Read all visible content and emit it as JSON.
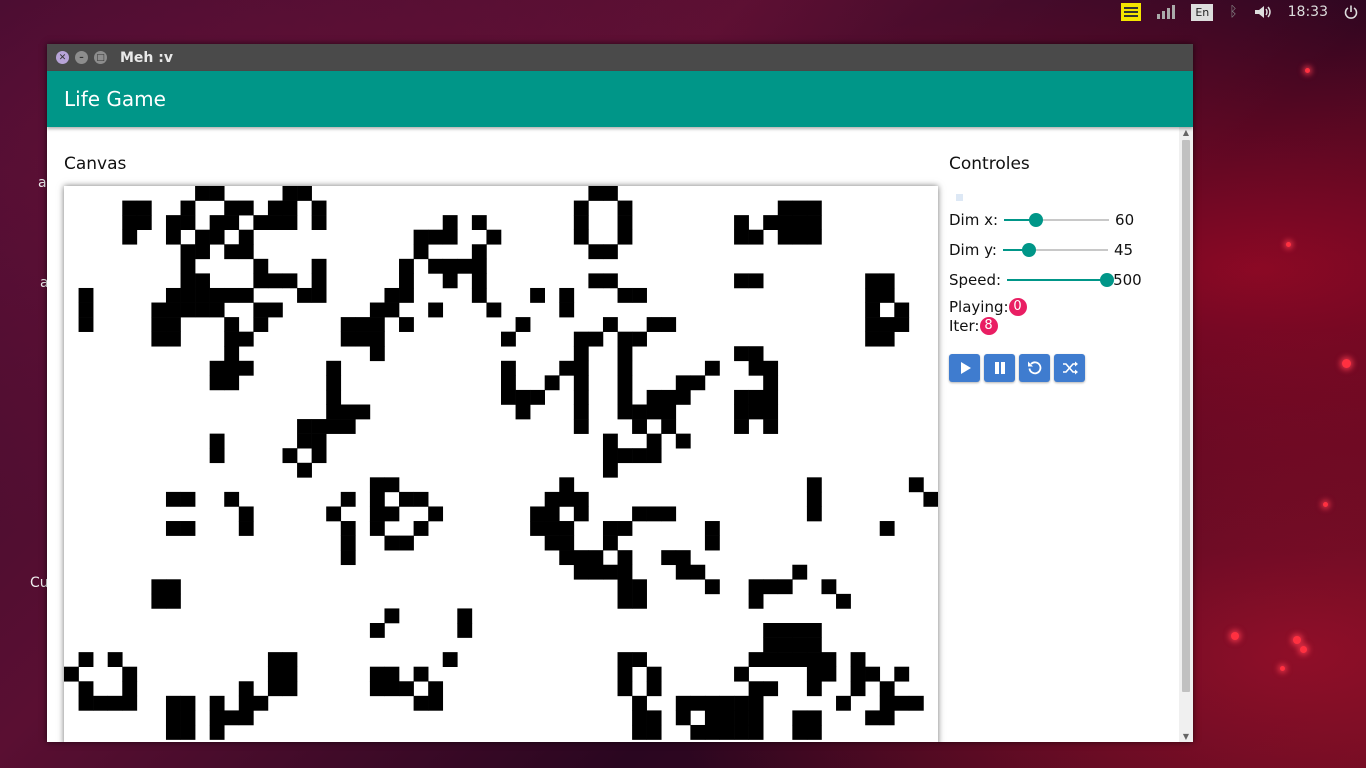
{
  "top_panel": {
    "language": "En",
    "clock": "18:33"
  },
  "desktop": {
    "glyphs": [
      "a",
      "a",
      "Cu"
    ]
  },
  "window": {
    "title": "Meh :v",
    "app_title": "Life Game",
    "canvas_heading": "Canvas",
    "controls_heading": "Controles",
    "sliders": [
      {
        "label": "Dim x:",
        "value": "60",
        "level": 0.3
      },
      {
        "label": "Dim y:",
        "value": "45",
        "level": 0.25
      },
      {
        "label": "Speed:",
        "value": "500",
        "level": 1.0
      }
    ],
    "playing_label": "Playing:",
    "playing_value": "0",
    "iter_label": "Iter:",
    "iter_value": "8",
    "buttons": [
      "play-icon",
      "pause-icon",
      "reset-icon",
      "shuffle-icon"
    ],
    "accent_color": "#009688",
    "button_color": "#3f7ccf",
    "badge_color": "#e91e63"
  },
  "grid": {
    "cols": 60,
    "visible_rows": 38,
    "live_cells": [
      [
        9,
        0
      ],
      [
        10,
        0
      ],
      [
        15,
        0
      ],
      [
        16,
        0
      ],
      [
        36,
        0
      ],
      [
        37,
        0
      ],
      [
        4,
        1
      ],
      [
        5,
        1
      ],
      [
        8,
        1
      ],
      [
        11,
        1
      ],
      [
        12,
        1
      ],
      [
        14,
        1
      ],
      [
        15,
        1
      ],
      [
        17,
        1
      ],
      [
        35,
        1
      ],
      [
        38,
        1
      ],
      [
        49,
        1
      ],
      [
        50,
        1
      ],
      [
        51,
        1
      ],
      [
        4,
        2
      ],
      [
        5,
        2
      ],
      [
        7,
        2
      ],
      [
        8,
        2
      ],
      [
        10,
        2
      ],
      [
        11,
        2
      ],
      [
        13,
        2
      ],
      [
        14,
        2
      ],
      [
        15,
        2
      ],
      [
        17,
        2
      ],
      [
        26,
        2
      ],
      [
        28,
        2
      ],
      [
        35,
        2
      ],
      [
        38,
        2
      ],
      [
        46,
        2
      ],
      [
        48,
        2
      ],
      [
        49,
        2
      ],
      [
        50,
        2
      ],
      [
        51,
        2
      ],
      [
        4,
        3
      ],
      [
        7,
        3
      ],
      [
        9,
        3
      ],
      [
        10,
        3
      ],
      [
        12,
        3
      ],
      [
        24,
        3
      ],
      [
        25,
        3
      ],
      [
        26,
        3
      ],
      [
        29,
        3
      ],
      [
        35,
        3
      ],
      [
        38,
        3
      ],
      [
        46,
        3
      ],
      [
        47,
        3
      ],
      [
        49,
        3
      ],
      [
        50,
        3
      ],
      [
        51,
        3
      ],
      [
        8,
        4
      ],
      [
        9,
        4
      ],
      [
        11,
        4
      ],
      [
        12,
        4
      ],
      [
        24,
        4
      ],
      [
        28,
        4
      ],
      [
        36,
        4
      ],
      [
        37,
        4
      ],
      [
        8,
        5
      ],
      [
        13,
        5
      ],
      [
        17,
        5
      ],
      [
        23,
        5
      ],
      [
        25,
        5
      ],
      [
        26,
        5
      ],
      [
        27,
        5
      ],
      [
        28,
        5
      ],
      [
        8,
        6
      ],
      [
        9,
        6
      ],
      [
        13,
        6
      ],
      [
        14,
        6
      ],
      [
        15,
        6
      ],
      [
        17,
        6
      ],
      [
        23,
        6
      ],
      [
        26,
        6
      ],
      [
        28,
        6
      ],
      [
        36,
        6
      ],
      [
        37,
        6
      ],
      [
        46,
        6
      ],
      [
        47,
        6
      ],
      [
        55,
        6
      ],
      [
        56,
        6
      ],
      [
        1,
        7
      ],
      [
        7,
        7
      ],
      [
        8,
        7
      ],
      [
        9,
        7
      ],
      [
        10,
        7
      ],
      [
        11,
        7
      ],
      [
        12,
        7
      ],
      [
        16,
        7
      ],
      [
        17,
        7
      ],
      [
        22,
        7
      ],
      [
        23,
        7
      ],
      [
        28,
        7
      ],
      [
        32,
        7
      ],
      [
        34,
        7
      ],
      [
        38,
        7
      ],
      [
        39,
        7
      ],
      [
        55,
        7
      ],
      [
        56,
        7
      ],
      [
        1,
        8
      ],
      [
        6,
        8
      ],
      [
        7,
        8
      ],
      [
        8,
        8
      ],
      [
        9,
        8
      ],
      [
        10,
        8
      ],
      [
        13,
        8
      ],
      [
        14,
        8
      ],
      [
        21,
        8
      ],
      [
        22,
        8
      ],
      [
        25,
        8
      ],
      [
        29,
        8
      ],
      [
        34,
        8
      ],
      [
        55,
        8
      ],
      [
        57,
        8
      ],
      [
        1,
        9
      ],
      [
        6,
        9
      ],
      [
        7,
        9
      ],
      [
        11,
        9
      ],
      [
        13,
        9
      ],
      [
        19,
        9
      ],
      [
        20,
        9
      ],
      [
        21,
        9
      ],
      [
        23,
        9
      ],
      [
        31,
        9
      ],
      [
        37,
        9
      ],
      [
        40,
        9
      ],
      [
        41,
        9
      ],
      [
        55,
        9
      ],
      [
        56,
        9
      ],
      [
        57,
        9
      ],
      [
        6,
        10
      ],
      [
        7,
        10
      ],
      [
        11,
        10
      ],
      [
        12,
        10
      ],
      [
        19,
        10
      ],
      [
        20,
        10
      ],
      [
        21,
        10
      ],
      [
        30,
        10
      ],
      [
        35,
        10
      ],
      [
        36,
        10
      ],
      [
        38,
        10
      ],
      [
        39,
        10
      ],
      [
        55,
        10
      ],
      [
        56,
        10
      ],
      [
        11,
        11
      ],
      [
        21,
        11
      ],
      [
        35,
        11
      ],
      [
        38,
        11
      ],
      [
        46,
        11
      ],
      [
        47,
        11
      ],
      [
        10,
        12
      ],
      [
        11,
        12
      ],
      [
        12,
        12
      ],
      [
        18,
        12
      ],
      [
        30,
        12
      ],
      [
        34,
        12
      ],
      [
        35,
        12
      ],
      [
        38,
        12
      ],
      [
        44,
        12
      ],
      [
        47,
        12
      ],
      [
        48,
        12
      ],
      [
        10,
        13
      ],
      [
        11,
        13
      ],
      [
        18,
        13
      ],
      [
        30,
        13
      ],
      [
        33,
        13
      ],
      [
        35,
        13
      ],
      [
        38,
        13
      ],
      [
        42,
        13
      ],
      [
        43,
        13
      ],
      [
        48,
        13
      ],
      [
        18,
        14
      ],
      [
        30,
        14
      ],
      [
        31,
        14
      ],
      [
        32,
        14
      ],
      [
        35,
        14
      ],
      [
        38,
        14
      ],
      [
        40,
        14
      ],
      [
        41,
        14
      ],
      [
        42,
        14
      ],
      [
        46,
        14
      ],
      [
        47,
        14
      ],
      [
        48,
        14
      ],
      [
        18,
        15
      ],
      [
        19,
        15
      ],
      [
        20,
        15
      ],
      [
        31,
        15
      ],
      [
        35,
        15
      ],
      [
        38,
        15
      ],
      [
        39,
        15
      ],
      [
        40,
        15
      ],
      [
        41,
        15
      ],
      [
        46,
        15
      ],
      [
        47,
        15
      ],
      [
        48,
        15
      ],
      [
        16,
        16
      ],
      [
        17,
        16
      ],
      [
        18,
        16
      ],
      [
        19,
        16
      ],
      [
        35,
        16
      ],
      [
        39,
        16
      ],
      [
        41,
        16
      ],
      [
        46,
        16
      ],
      [
        48,
        16
      ],
      [
        10,
        17
      ],
      [
        16,
        17
      ],
      [
        17,
        17
      ],
      [
        37,
        17
      ],
      [
        40,
        17
      ],
      [
        42,
        17
      ],
      [
        10,
        18
      ],
      [
        15,
        18
      ],
      [
        17,
        18
      ],
      [
        37,
        18
      ],
      [
        38,
        18
      ],
      [
        39,
        18
      ],
      [
        40,
        18
      ],
      [
        16,
        19
      ],
      [
        37,
        19
      ],
      [
        21,
        20
      ],
      [
        22,
        20
      ],
      [
        34,
        20
      ],
      [
        51,
        20
      ],
      [
        58,
        20
      ],
      [
        7,
        21
      ],
      [
        8,
        21
      ],
      [
        11,
        21
      ],
      [
        19,
        21
      ],
      [
        21,
        21
      ],
      [
        23,
        21
      ],
      [
        24,
        21
      ],
      [
        33,
        21
      ],
      [
        34,
        21
      ],
      [
        35,
        21
      ],
      [
        51,
        21
      ],
      [
        59,
        21
      ],
      [
        12,
        22
      ],
      [
        18,
        22
      ],
      [
        21,
        22
      ],
      [
        22,
        22
      ],
      [
        25,
        22
      ],
      [
        32,
        22
      ],
      [
        33,
        22
      ],
      [
        35,
        22
      ],
      [
        39,
        22
      ],
      [
        40,
        22
      ],
      [
        41,
        22
      ],
      [
        51,
        22
      ],
      [
        7,
        23
      ],
      [
        8,
        23
      ],
      [
        12,
        23
      ],
      [
        19,
        23
      ],
      [
        21,
        23
      ],
      [
        24,
        23
      ],
      [
        32,
        23
      ],
      [
        33,
        23
      ],
      [
        34,
        23
      ],
      [
        37,
        23
      ],
      [
        38,
        23
      ],
      [
        44,
        23
      ],
      [
        56,
        23
      ],
      [
        19,
        24
      ],
      [
        22,
        24
      ],
      [
        23,
        24
      ],
      [
        33,
        24
      ],
      [
        34,
        24
      ],
      [
        37,
        24
      ],
      [
        44,
        24
      ],
      [
        19,
        25
      ],
      [
        34,
        25
      ],
      [
        35,
        25
      ],
      [
        36,
        25
      ],
      [
        38,
        25
      ],
      [
        41,
        25
      ],
      [
        42,
        25
      ],
      [
        35,
        26
      ],
      [
        36,
        26
      ],
      [
        37,
        26
      ],
      [
        38,
        26
      ],
      [
        42,
        26
      ],
      [
        43,
        26
      ],
      [
        50,
        26
      ],
      [
        6,
        27
      ],
      [
        7,
        27
      ],
      [
        38,
        27
      ],
      [
        39,
        27
      ],
      [
        44,
        27
      ],
      [
        47,
        27
      ],
      [
        48,
        27
      ],
      [
        49,
        27
      ],
      [
        52,
        27
      ],
      [
        6,
        28
      ],
      [
        7,
        28
      ],
      [
        38,
        28
      ],
      [
        39,
        28
      ],
      [
        47,
        28
      ],
      [
        53,
        28
      ],
      [
        22,
        29
      ],
      [
        27,
        29
      ],
      [
        21,
        30
      ],
      [
        27,
        30
      ],
      [
        48,
        30
      ],
      [
        49,
        30
      ],
      [
        50,
        30
      ],
      [
        51,
        30
      ],
      [
        48,
        31
      ],
      [
        49,
        31
      ],
      [
        50,
        31
      ],
      [
        51,
        31
      ],
      [
        1,
        32
      ],
      [
        3,
        32
      ],
      [
        14,
        32
      ],
      [
        15,
        32
      ],
      [
        26,
        32
      ],
      [
        38,
        32
      ],
      [
        39,
        32
      ],
      [
        47,
        32
      ],
      [
        48,
        32
      ],
      [
        49,
        32
      ],
      [
        50,
        32
      ],
      [
        51,
        32
      ],
      [
        52,
        32
      ],
      [
        54,
        32
      ],
      [
        0,
        33
      ],
      [
        4,
        33
      ],
      [
        14,
        33
      ],
      [
        15,
        33
      ],
      [
        21,
        33
      ],
      [
        22,
        33
      ],
      [
        24,
        33
      ],
      [
        38,
        33
      ],
      [
        40,
        33
      ],
      [
        46,
        33
      ],
      [
        51,
        33
      ],
      [
        52,
        33
      ],
      [
        54,
        33
      ],
      [
        55,
        33
      ],
      [
        57,
        33
      ],
      [
        1,
        34
      ],
      [
        4,
        34
      ],
      [
        12,
        34
      ],
      [
        14,
        34
      ],
      [
        15,
        34
      ],
      [
        21,
        34
      ],
      [
        22,
        34
      ],
      [
        23,
        34
      ],
      [
        25,
        34
      ],
      [
        38,
        34
      ],
      [
        40,
        34
      ],
      [
        47,
        34
      ],
      [
        48,
        34
      ],
      [
        51,
        34
      ],
      [
        54,
        34
      ],
      [
        56,
        34
      ],
      [
        1,
        35
      ],
      [
        2,
        35
      ],
      [
        3,
        35
      ],
      [
        4,
        35
      ],
      [
        7,
        35
      ],
      [
        8,
        35
      ],
      [
        10,
        35
      ],
      [
        12,
        35
      ],
      [
        13,
        35
      ],
      [
        24,
        35
      ],
      [
        25,
        35
      ],
      [
        39,
        35
      ],
      [
        42,
        35
      ],
      [
        43,
        35
      ],
      [
        44,
        35
      ],
      [
        45,
        35
      ],
      [
        46,
        35
      ],
      [
        47,
        35
      ],
      [
        53,
        35
      ],
      [
        56,
        35
      ],
      [
        57,
        35
      ],
      [
        58,
        35
      ],
      [
        7,
        36
      ],
      [
        8,
        36
      ],
      [
        10,
        36
      ],
      [
        11,
        36
      ],
      [
        12,
        36
      ],
      [
        39,
        36
      ],
      [
        40,
        36
      ],
      [
        42,
        36
      ],
      [
        44,
        36
      ],
      [
        45,
        36
      ],
      [
        46,
        36
      ],
      [
        47,
        36
      ],
      [
        50,
        36
      ],
      [
        51,
        36
      ],
      [
        55,
        36
      ],
      [
        56,
        36
      ],
      [
        7,
        37
      ],
      [
        8,
        37
      ],
      [
        10,
        37
      ],
      [
        39,
        37
      ],
      [
        40,
        37
      ],
      [
        43,
        37
      ],
      [
        44,
        37
      ],
      [
        45,
        37
      ],
      [
        46,
        37
      ],
      [
        47,
        37
      ],
      [
        50,
        37
      ],
      [
        51,
        37
      ]
    ]
  }
}
